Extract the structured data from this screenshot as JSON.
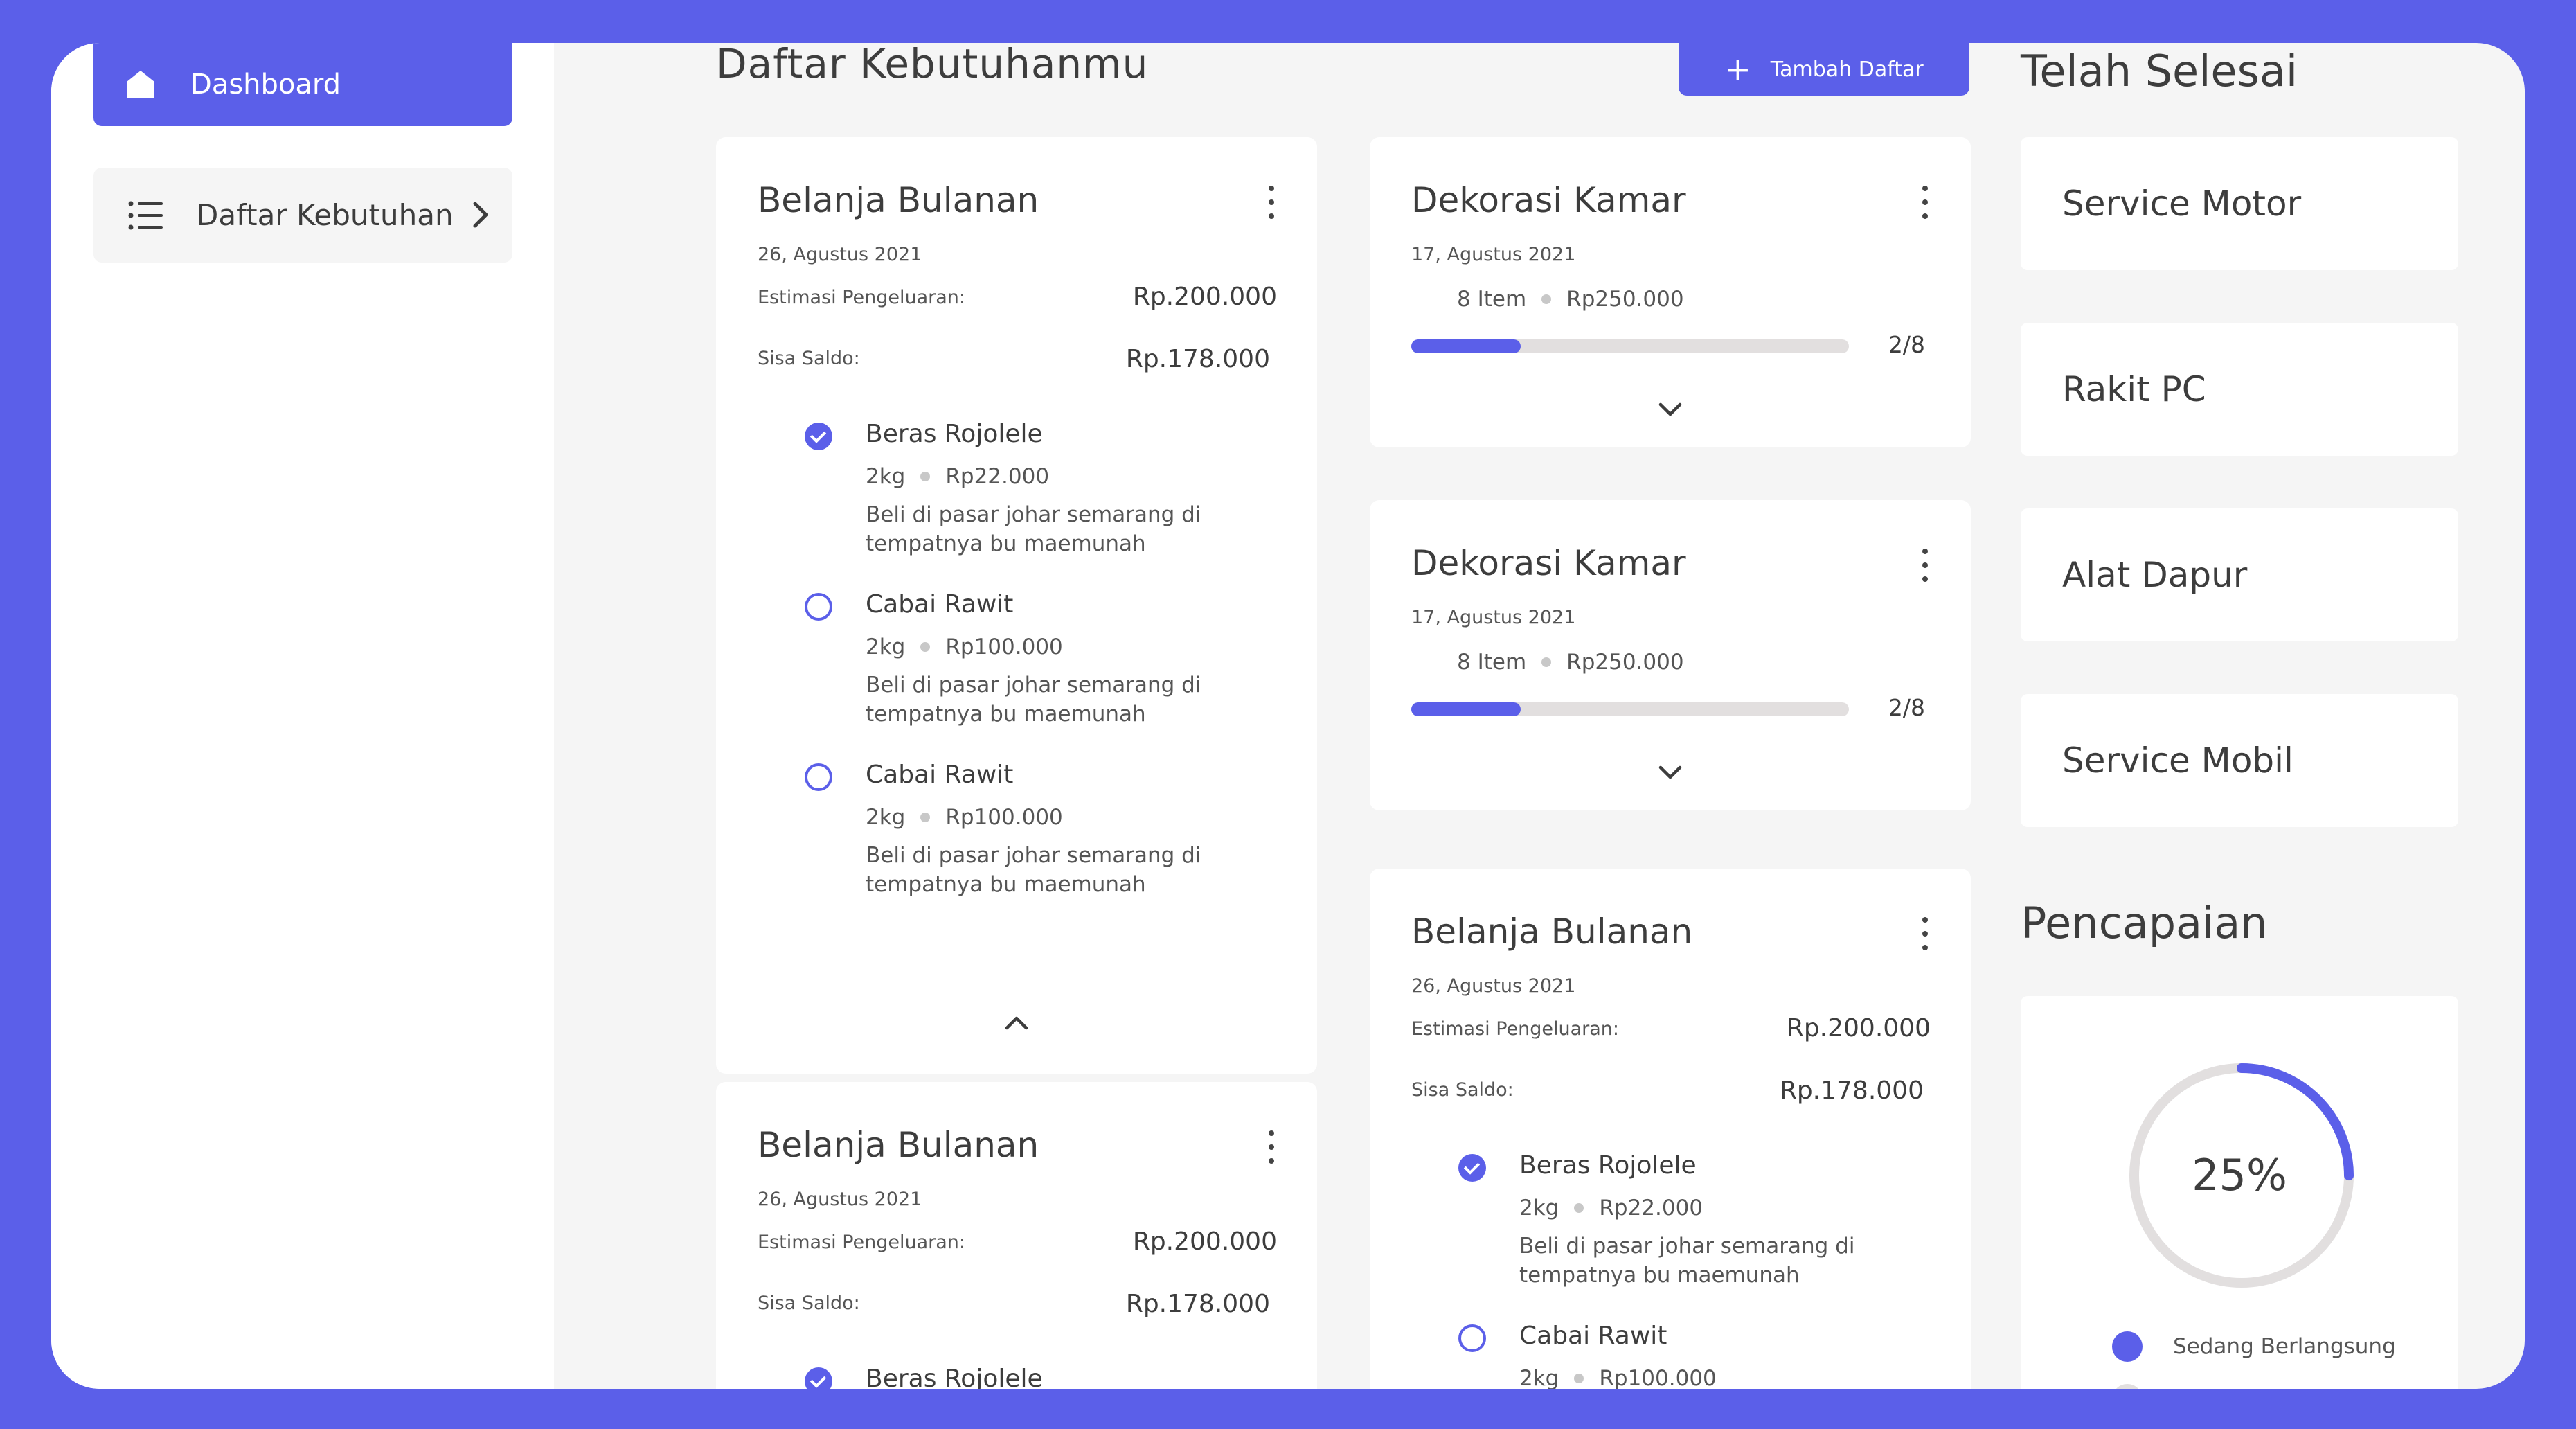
{
  "colors": {
    "accent": "#5b5fe9",
    "track": "#e2dfdf",
    "frame": "#5b5fe9",
    "secondary_legend": "#e2dfdf"
  },
  "sidebar": {
    "dashboard_label": "Dashboard",
    "dashboard_icon": "home-icon",
    "daftar_label": "Daftar Kebutuhan",
    "daftar_icon": "list-icon"
  },
  "header": {
    "title": "Daftar Kebutuhanmu",
    "add_button": "Tambah Daftar",
    "add_icon": "plus-icon"
  },
  "cards": {
    "belanja1": {
      "title": "Belanja Bulanan",
      "date": "26, Agustus 2021",
      "estimasi_label": "Estimasi Pengeluaran:",
      "estimasi_value": "Rp.200.000",
      "sisa_label": "Sisa Saldo:",
      "sisa_value": "Rp.178.000",
      "items": [
        {
          "name": "Beras Rojolele",
          "qty": "2kg",
          "price": "Rp22.000",
          "note": "Beli di pasar johar semarang di tempatnya bu maemunah",
          "checked": true
        },
        {
          "name": "Cabai Rawit",
          "qty": "2kg",
          "price": "Rp100.000",
          "note": "Beli di pasar johar semarang di tempatnya bu maemunah",
          "checked": false
        },
        {
          "name": "Cabai Rawit",
          "qty": "2kg",
          "price": "Rp100.000",
          "note": "Beli di pasar johar semarang di tempatnya bu maemunah",
          "checked": false
        }
      ]
    },
    "belanja2": {
      "title": "Belanja Bulanan",
      "date": "26, Agustus 2021",
      "estimasi_label": "Estimasi Pengeluaran:",
      "estimasi_value": "Rp.200.000",
      "sisa_label": "Sisa Saldo:",
      "sisa_value": "Rp.178.000",
      "items": [
        {
          "name": "Beras Rojolele",
          "checked": true
        }
      ]
    },
    "dekorasi1": {
      "title": "Dekorasi Kamar",
      "date": "17, Agustus 2021",
      "item_count": "8 Item",
      "price": "Rp250.000",
      "progress_text": "2/8",
      "progress": 0.25
    },
    "dekorasi2": {
      "title": "Dekorasi Kamar",
      "date": "17, Agustus 2021",
      "item_count": "8 Item",
      "price": "Rp250.000",
      "progress_text": "2/8",
      "progress": 0.25
    },
    "belanja3": {
      "title": "Belanja Bulanan",
      "date": "26, Agustus 2021",
      "estimasi_label": "Estimasi Pengeluaran:",
      "estimasi_value": "Rp.200.000",
      "sisa_label": "Sisa Saldo:",
      "sisa_value": "Rp.178.000",
      "items": [
        {
          "name": "Beras Rojolele",
          "qty": "2kg",
          "price": "Rp22.000",
          "note": "Beli di pasar johar semarang di tempatnya bu maemunah",
          "checked": true
        },
        {
          "name": "Cabai Rawit",
          "qty": "2kg",
          "price": "Rp100.000",
          "checked": false
        }
      ]
    }
  },
  "completed": {
    "title": "Telah Selesai",
    "items": [
      "Service Motor",
      "Rakit PC",
      "Alat Dapur",
      "Service Mobil"
    ]
  },
  "achievement": {
    "title": "Pencapaian",
    "percent_label": "25%",
    "percent": 25,
    "legend": [
      "Sedang Berlangsung"
    ]
  }
}
